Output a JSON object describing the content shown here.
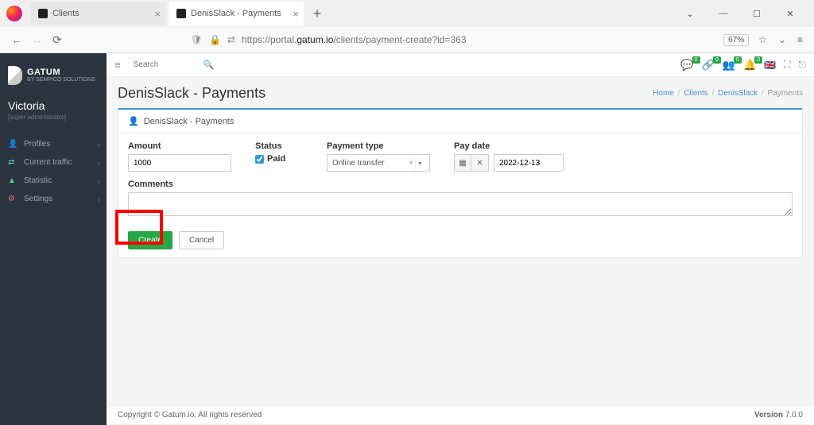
{
  "browser": {
    "tabs": [
      {
        "title": "Clients"
      },
      {
        "title": "DenisSlack - Payments"
      }
    ],
    "url_pre": "https://portal.",
    "url_host": "gatum.io",
    "url_path": "/clients/payment-create?id=363",
    "zoom": "67%"
  },
  "brand": {
    "title": "GATUM",
    "subtitle": "BY SEMPICO SOLUTIONS"
  },
  "user": {
    "name": "Victoria",
    "role": "[super administrator]"
  },
  "sidebar": {
    "items": [
      {
        "label": "Profiles",
        "icon_color": "#6bb5e8"
      },
      {
        "label": "Current traffic",
        "icon_color": "#5dc7c7"
      },
      {
        "label": "Statistic",
        "icon_color": "#5fcf7a"
      },
      {
        "label": "Settings",
        "icon_color": "#e36f6f"
      }
    ]
  },
  "topbar": {
    "search_placeholder": "Search",
    "badges": [
      "0",
      "0",
      "0",
      "0"
    ]
  },
  "page": {
    "title": "DenisSlack - Payments"
  },
  "breadcrumbs": {
    "home": "Home",
    "clients": "Clients",
    "client": "DenisSlack",
    "current": "Payments"
  },
  "card": {
    "title": "DenisSlack - Payments"
  },
  "form": {
    "amount_label": "Amount",
    "amount_value": "1000",
    "status_label": "Status",
    "paid_label": "Paid",
    "payment_type_label": "Payment type",
    "payment_type_value": "Online transfer",
    "pay_date_label": "Pay date",
    "pay_date_value": "2022-12-13",
    "comments_label": "Comments",
    "comments_value": "",
    "create_btn": "Create",
    "cancel_btn": "Cancel"
  },
  "footer": {
    "copyright": "Copyright © Gatum.io. All rights reserved",
    "version_label": "Version ",
    "version": "7.0.0"
  }
}
